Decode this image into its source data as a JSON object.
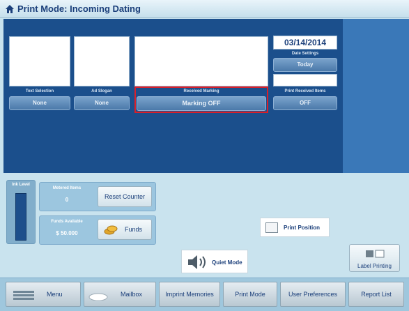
{
  "window": {
    "title": "Print Mode: Incoming Dating"
  },
  "preview": {
    "date": "03/14/2014",
    "text_selection": {
      "label": "Text Selection",
      "value": "None"
    },
    "ad_slogan": {
      "label": "Ad Slogan",
      "value": "None"
    },
    "received_marking": {
      "label": "Received Marking",
      "value": "Marking OFF"
    },
    "date_settings": {
      "label": "Date Settings",
      "value": "Today"
    },
    "print_received_items": {
      "label": "Print Received Items",
      "value": "OFF"
    }
  },
  "status": {
    "ink_level": {
      "label": "Ink Level"
    },
    "metered_items": {
      "label": "Metered Items",
      "value": "0"
    },
    "reset_counter_label": "Reset Counter",
    "funds_available": {
      "label": "Funds Available",
      "value": "$ 50.000"
    },
    "funds_label": "Funds"
  },
  "actions": {
    "print_position": "Print Position",
    "quiet_mode": "Quiet Mode",
    "label_printing": "Label Printing"
  },
  "nav": [
    {
      "label": "Menu"
    },
    {
      "label": "Mailbox"
    },
    {
      "label": "Imprint Memories"
    },
    {
      "label": "Print Mode"
    },
    {
      "label": "User Preferences"
    },
    {
      "label": "Report List"
    }
  ],
  "colors": {
    "panel_dark": "#1b4f8c",
    "highlight": "#d8202a",
    "background": "#c9e3ee"
  }
}
